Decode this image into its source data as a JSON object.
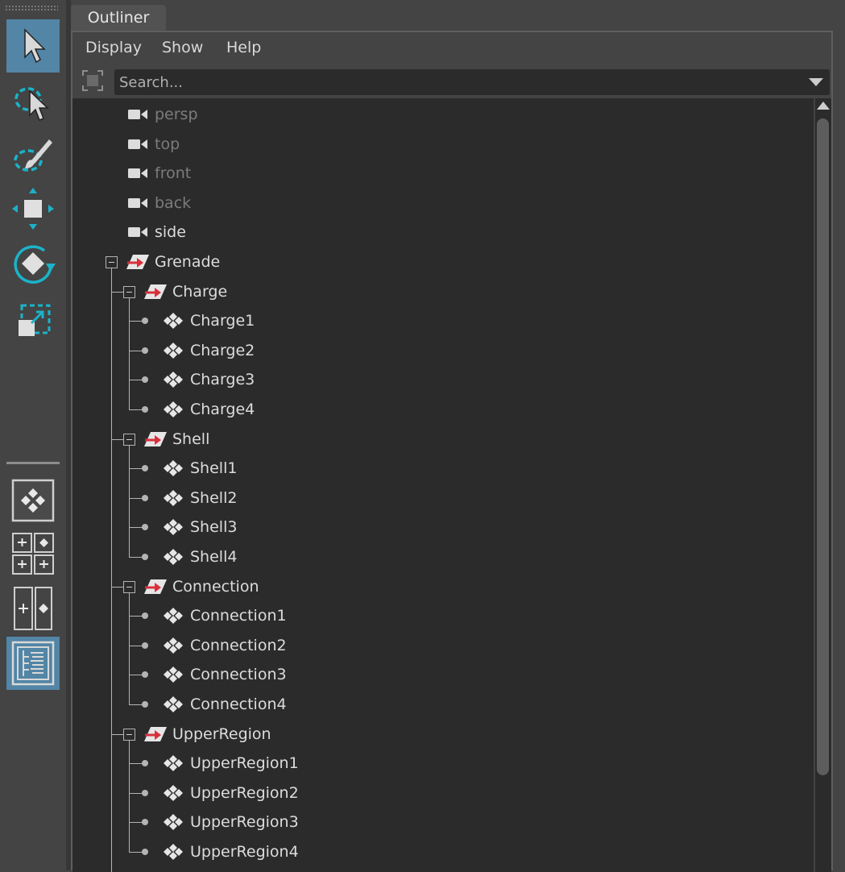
{
  "panel": {
    "tab_label": "Outliner"
  },
  "menubar": {
    "items": [
      "Display",
      "Show",
      "Help"
    ]
  },
  "search": {
    "placeholder": "Search..."
  },
  "tree": {
    "cameras": [
      {
        "label": "persp",
        "hidden": true
      },
      {
        "label": "top",
        "hidden": true
      },
      {
        "label": "front",
        "hidden": true
      },
      {
        "label": "back",
        "hidden": true
      },
      {
        "label": "side",
        "hidden": false
      }
    ],
    "root": {
      "label": "Grenade",
      "groups": [
        {
          "label": "Charge",
          "children": [
            "Charge1",
            "Charge2",
            "Charge3",
            "Charge4"
          ]
        },
        {
          "label": "Shell",
          "children": [
            "Shell1",
            "Shell2",
            "Shell3",
            "Shell4"
          ]
        },
        {
          "label": "Connection",
          "children": [
            "Connection1",
            "Connection2",
            "Connection3",
            "Connection4"
          ]
        },
        {
          "label": "UpperRegion",
          "children": [
            "UpperRegion1",
            "UpperRegion2",
            "UpperRegion3",
            "UpperRegion4"
          ]
        }
      ]
    }
  },
  "icons": {
    "camera": "camera-icon",
    "group": "transform-group-icon",
    "mesh": "mesh-node-icon",
    "expand": "collapse-toggle-icon"
  },
  "colors": {
    "accent": "#5285a6",
    "tool_cyan": "#1bb3c9",
    "group_arrow": "#d8303a",
    "tree_bg": "#2b2b2b",
    "panel_bg": "#444444"
  }
}
